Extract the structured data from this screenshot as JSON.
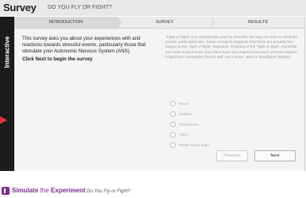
{
  "header": {
    "title": "Survey",
    "subtitle": "DO YOU FLY OR FIGHT?"
  },
  "sidetab": {
    "label": "Interactive"
  },
  "steps": [
    "INTRODUCTION",
    "SURVEY",
    "RESULTS"
  ],
  "intro": {
    "text": "This survey asks you about your experiences with and reactions towards stressful events, particularly those that stimulate your Autonomic Nervous System (ANS).",
    "cta": "Click Next to begin the survey"
  },
  "question": {
    "text": "\"Fight or flight\" is a catchphrase used to describe the way we react to stressful events, particularly two. Some research suggests that there are actually four stages to the \"fight or flight\" response. Thinking of the \"fight or flight\" moments you have experienced, how often have you experienced each of these stages? Fright/Tonic immobility (freeze stiff, can't move, 'deer in headlights' feeling)",
    "options": [
      "Never",
      "Seldom",
      "Sometimes",
      "Often",
      "Prefer not to state"
    ]
  },
  "buttons": {
    "previous": "Previous",
    "next": "Next"
  },
  "footer": {
    "part1": "Simulate",
    "part2": " the ",
    "part3": "Experiment",
    "part4": " Do You Fly or Fight?"
  }
}
